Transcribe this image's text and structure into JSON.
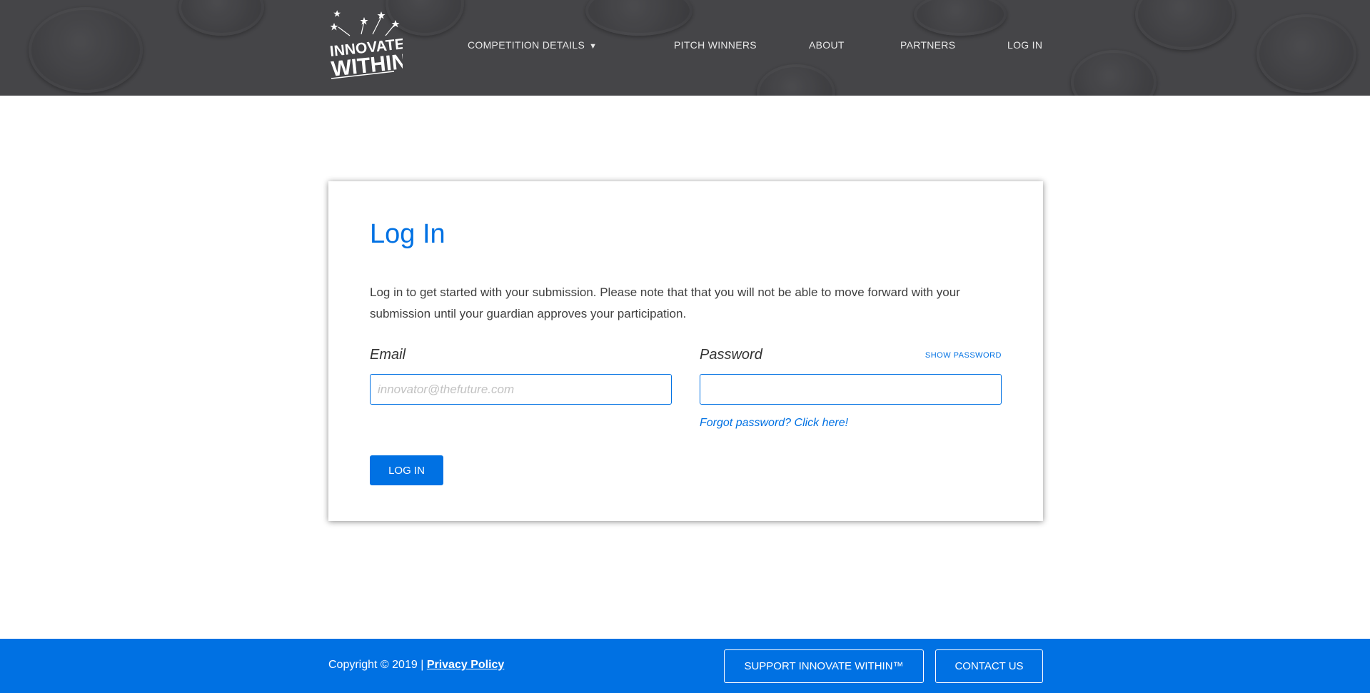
{
  "header": {
    "logo": {
      "line1": "INNOVATE",
      "line2": "WITHIN"
    },
    "nav": [
      {
        "label": "COMPETITION DETAILS",
        "has_dropdown": true
      },
      {
        "label": "PITCH WINNERS"
      },
      {
        "label": "ABOUT"
      },
      {
        "label": "PARTNERS"
      },
      {
        "label": "LOG IN"
      }
    ],
    "dropdown_caret": "▼"
  },
  "login": {
    "title": "Log In",
    "description": "Log in to get started with your submission. Please note that that you will not be able to move forward with your submission until your guardian approves your participation.",
    "email_label": "Email",
    "email_placeholder": "innovator@thefuture.com",
    "email_value": "",
    "password_label": "Password",
    "password_value": "",
    "show_password": "SHOW PASSWORD",
    "forgot_password": "Forgot password? Click here!",
    "submit_label": "LOG IN"
  },
  "footer": {
    "copyright": "Copyright © 2019 |",
    "privacy_link": "Privacy Policy",
    "support_button": "SUPPORT INNOVATE WITHIN™",
    "contact_button": "CONTACT US"
  },
  "colors": {
    "accent": "#0071e3",
    "header_bg": "#454548",
    "footer_bg": "#0071e3"
  }
}
